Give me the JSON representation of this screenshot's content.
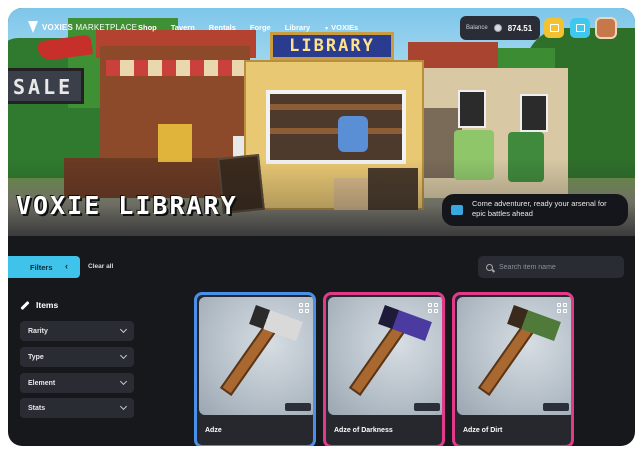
{
  "nav": {
    "logo_bold": "VOXIES",
    "logo_thin": "MARKETPLACE",
    "links": [
      "Shop",
      "Tavern",
      "Rentals",
      "Forge",
      "Library",
      "VOXIEs"
    ],
    "balance_label": "Balance",
    "balance_value": "874.51"
  },
  "hero": {
    "sign_text": "LIBRARY",
    "sale_text": "SALE",
    "title": "VOXIE LIBRARY",
    "tip_text": "Come adventurer, ready your arsenal for epic battles ahead"
  },
  "toolbar": {
    "filters_label": "Filters",
    "filters_chevron": "‹",
    "clear_label": "Clear all",
    "search_placeholder": "Search item name"
  },
  "sidebar": {
    "title": "Items",
    "filters": [
      "Rarity",
      "Type",
      "Element",
      "Stats"
    ]
  },
  "items": [
    {
      "name": "Adze",
      "border": "#4a8fe8",
      "head": "#d9d9d9",
      "accent": "#2a2a2a"
    },
    {
      "name": "Adze of Darkness",
      "border": "#e23a8a",
      "head": "#4b3aa0",
      "accent": "#1d1a3a"
    },
    {
      "name": "Adze of Dirt",
      "border": "#e23a8a",
      "head": "#4f7a3a",
      "accent": "#3a2a1c"
    }
  ],
  "colors": {
    "accent": "#3fc3ea",
    "background": "#17181c",
    "panel": "#2a2c33",
    "yellow_button": "#f2c230"
  }
}
